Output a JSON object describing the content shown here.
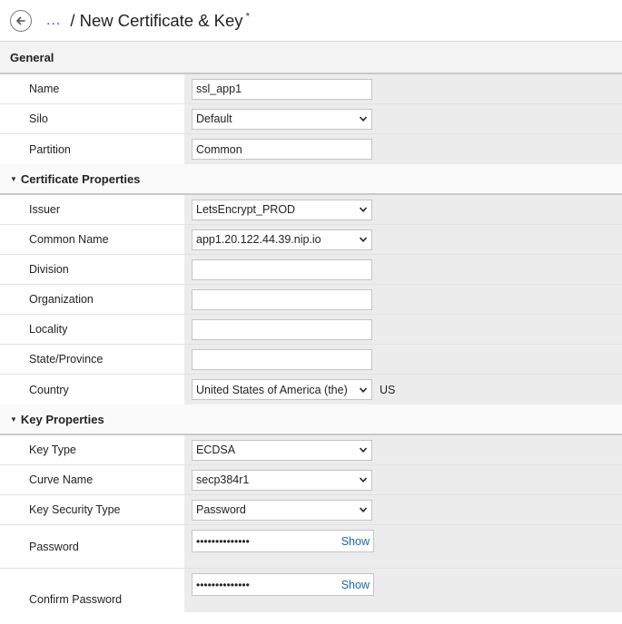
{
  "header": {
    "breadcrumb_dots": "...",
    "title": "/ New Certificate & Key",
    "modified_mark": "*"
  },
  "general": {
    "heading": "General",
    "fields": {
      "name": {
        "label": "Name",
        "value": "ssl_app1"
      },
      "silo": {
        "label": "Silo",
        "value": "Default"
      },
      "partition": {
        "label": "Partition",
        "value": "Common"
      }
    }
  },
  "certificate": {
    "heading": "Certificate Properties",
    "fields": {
      "issuer": {
        "label": "Issuer",
        "value": "LetsEncrypt_PROD"
      },
      "common_name": {
        "label": "Common Name",
        "value": "app1.20.122.44.39.nip.io"
      },
      "division": {
        "label": "Division",
        "value": ""
      },
      "organization": {
        "label": "Organization",
        "value": ""
      },
      "locality": {
        "label": "Locality",
        "value": ""
      },
      "state": {
        "label": "State/Province",
        "value": ""
      },
      "country": {
        "label": "Country",
        "value": "United States of America (the)",
        "code": "US"
      }
    }
  },
  "key": {
    "heading": "Key Properties",
    "fields": {
      "key_type": {
        "label": "Key Type",
        "value": "ECDSA"
      },
      "curve_name": {
        "label": "Curve Name",
        "value": "secp384r1"
      },
      "key_security_type": {
        "label": "Key Security Type",
        "value": "Password"
      },
      "password": {
        "label": "Password",
        "value": "••••••••••••••",
        "show_label": "Show"
      },
      "confirm_password": {
        "label": "Confirm Password",
        "value": "••••••••••••••",
        "show_label": "Show"
      }
    }
  },
  "icons": {
    "back": "back-arrow-icon",
    "chevron": "chevron-down-icon",
    "caret": "caret-down-icon"
  }
}
